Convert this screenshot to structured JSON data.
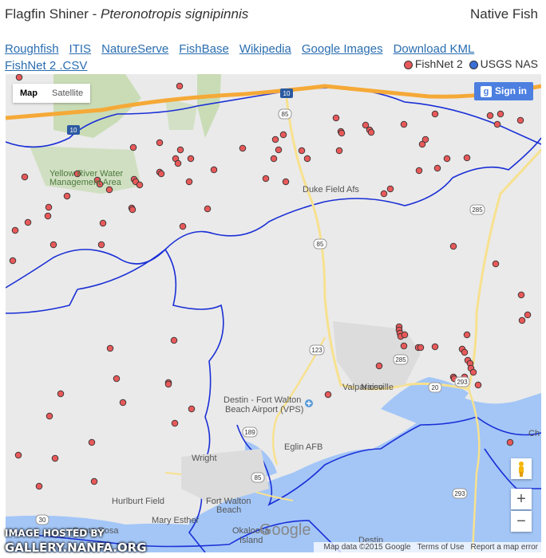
{
  "header": {
    "common_name": "Flagfin Shiner - ",
    "scientific_name": "Pteronotropis signipinnis",
    "status": "Native Fish"
  },
  "links": [
    "Roughfish",
    "ITIS",
    "NatureServe",
    "FishBase",
    "Wikipedia",
    "Google Images",
    "Download KML",
    "FishNet 2 .CSV"
  ],
  "legend": [
    {
      "label": "FishNet 2",
      "color": "#e8595a"
    },
    {
      "label": "USGS NAS",
      "color": "#3a6fd8"
    }
  ],
  "map": {
    "map_type": {
      "map": "Map",
      "satellite": "Satellite"
    },
    "sign_in": "Sign in",
    "sign_in_icon": "g-icon",
    "zoom_in": "+",
    "zoom_out": "−",
    "pegman_icon": "pegman-icon",
    "attribution": [
      "Map data ©2015 Google",
      "Terms of Use",
      "Report a map error"
    ],
    "watermark": "Google",
    "place_labels": [
      {
        "text": "Yellow River Water",
        "color": "#4b7a3c"
      },
      {
        "text": "Management Area",
        "color": "#4b7a3c"
      },
      {
        "text": "Duke Field Afs",
        "color": "#555"
      },
      {
        "text": "Niceville",
        "color": "#555"
      },
      {
        "text": "Valparaiso",
        "color": "#555"
      },
      {
        "text": "Destin - Fort Walton",
        "color": "#555"
      },
      {
        "text": "Beach Airport (VPS)",
        "color": "#555"
      },
      {
        "text": "Eglin AFB",
        "color": "#555"
      },
      {
        "text": "Wright",
        "color": "#555"
      },
      {
        "text": "Fort Walton",
        "color": "#555"
      },
      {
        "text": "Beach",
        "color": "#555"
      },
      {
        "text": "Hurlburt Field",
        "color": "#555"
      },
      {
        "text": "Mary Esther",
        "color": "#555"
      },
      {
        "text": "Okaloosa",
        "color": "#555"
      },
      {
        "text": "Island",
        "color": "#555"
      },
      {
        "text": "Santa Rosa",
        "color": "#555"
      },
      {
        "text": "Destin",
        "color": "#555"
      },
      {
        "text": "Ch",
        "color": "#555"
      }
    ],
    "road_shields": [
      "10",
      "10",
      "85",
      "85",
      "285",
      "123",
      "285",
      "20",
      "189",
      "85",
      "293",
      "98",
      "293",
      "30"
    ],
    "colors": {
      "land": "#eaeaea",
      "water": "#a3c6f7",
      "park": "#c9dcb6",
      "interstate": "#f5a937",
      "highway": "#f7e18e",
      "boundary": "#1a2fd6",
      "marker": "#e8595a"
    }
  },
  "hosted": {
    "line1": "IMAGE HOSTED BY",
    "line2": "GALLERY.NANFA.ORG"
  }
}
